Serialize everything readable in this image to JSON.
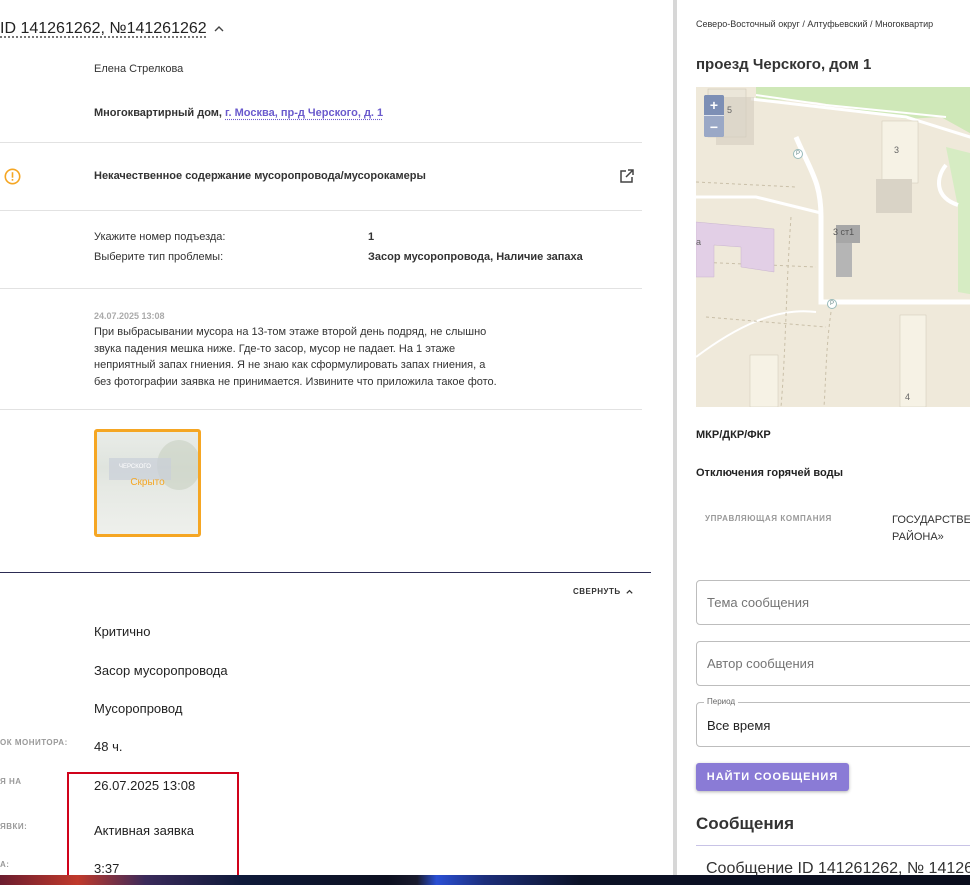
{
  "left": {
    "title": "ID 141261262, №141261262",
    "author": "Елена Стрелкова",
    "object_type": "Многоквартирный дом,",
    "object_address": "г. Москва, пр-д Черского, д. 1",
    "problem_title": "Некачественное содержание мусоропровода/мусорокамеры",
    "fields": [
      {
        "label": "Укажите номер подъезда:",
        "value": "1"
      },
      {
        "label": "Выберите тип проблемы:",
        "value": "Засор мусоропровода, Наличие запаха"
      }
    ],
    "comment_date": "24.07.2025 13:08",
    "comment_lines": [
      "При выбрасывании мусора на 13-том этаже второй день подряд, не слышно",
      "звука падения мешка ниже. Где-то засор, мусор не падает. На 1 этаже",
      "неприятный запах гниения. Я не знаю как сформулировать запах гниения, а",
      "без фотографии заявка не принимается. Извините что приложила такое фото."
    ],
    "photo_sign_text": "ЧЕРСКОГО",
    "photo_hidden_label": "Скрыто",
    "collapse_label": "СВЕРНУТЬ",
    "details": [
      {
        "label": "",
        "value": "Критично"
      },
      {
        "label": "",
        "value": "Засор мусоропровода"
      },
      {
        "label": "",
        "value": "Мусоропровод"
      },
      {
        "label": "ОК МОНИТОРА:",
        "value": "48 ч."
      },
      {
        "label": "Я НА",
        "value": "26.07.2025 13:08"
      },
      {
        "label": "ЯВКИ:",
        "value": "Активная заявка"
      },
      {
        "label": "А:",
        "value": "3:37"
      }
    ]
  },
  "right": {
    "breadcrumb": "Северо-Восточный округ / Алтуфьевский / Многоквартир",
    "address_title": "проезд Черского, дом 1",
    "map": {
      "zoom_in": "+",
      "zoom_out": "−",
      "labels": [
        "5",
        "3",
        "3 ст1",
        "а",
        "4",
        "P",
        "P"
      ]
    },
    "mkr_label": "МКР/ДКР/ФКР",
    "hot_water_label": "Отключения горячей воды",
    "uk_label": "УПРАВЛЯЮЩАЯ КОМПАНИЯ",
    "uk_value_lines": [
      "ГОСУДАРСТВЕ",
      "РАЙОНА»"
    ],
    "topic_placeholder": "Тема сообщения",
    "author_placeholder": "Автор сообщения",
    "period_label": "Период",
    "period_value": "Все время",
    "find_button": "НАЙТИ СООБЩЕНИЯ",
    "messages_heading": "Сообщения",
    "first_message": "Сообщение ID 141261262, № 14126"
  },
  "colors": {
    "accent": "#8a7bd6",
    "link": "#6a5acd",
    "warning": "#f5a623",
    "highlight_box": "#d0021b"
  }
}
